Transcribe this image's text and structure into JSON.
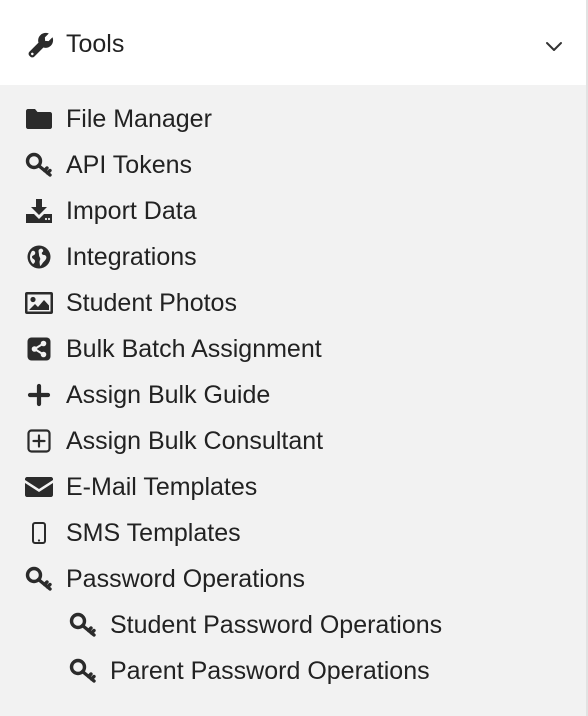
{
  "header": {
    "title": "Tools",
    "icon": "wrench-icon",
    "toggle_icon": "chevron-down-icon"
  },
  "menu": {
    "items": [
      {
        "label": "File Manager",
        "icon": "folder-icon"
      },
      {
        "label": "API Tokens",
        "icon": "key-icon"
      },
      {
        "label": "Import Data",
        "icon": "download-icon"
      },
      {
        "label": "Integrations",
        "icon": "globe-icon"
      },
      {
        "label": "Student Photos",
        "icon": "image-icon"
      },
      {
        "label": "Bulk Batch Assignment",
        "icon": "share-square-icon"
      },
      {
        "label": "Assign Bulk Guide",
        "icon": "plus-icon"
      },
      {
        "label": "Assign Bulk Consultant",
        "icon": "plus-square-icon"
      },
      {
        "label": "E-Mail Templates",
        "icon": "envelope-icon"
      },
      {
        "label": "SMS Templates",
        "icon": "mobile-icon"
      },
      {
        "label": "Password Operations",
        "icon": "key-icon"
      }
    ],
    "subitems": [
      {
        "label": "Student Password Operations",
        "icon": "key-icon"
      },
      {
        "label": "Parent Password Operations",
        "icon": "key-icon"
      }
    ]
  }
}
